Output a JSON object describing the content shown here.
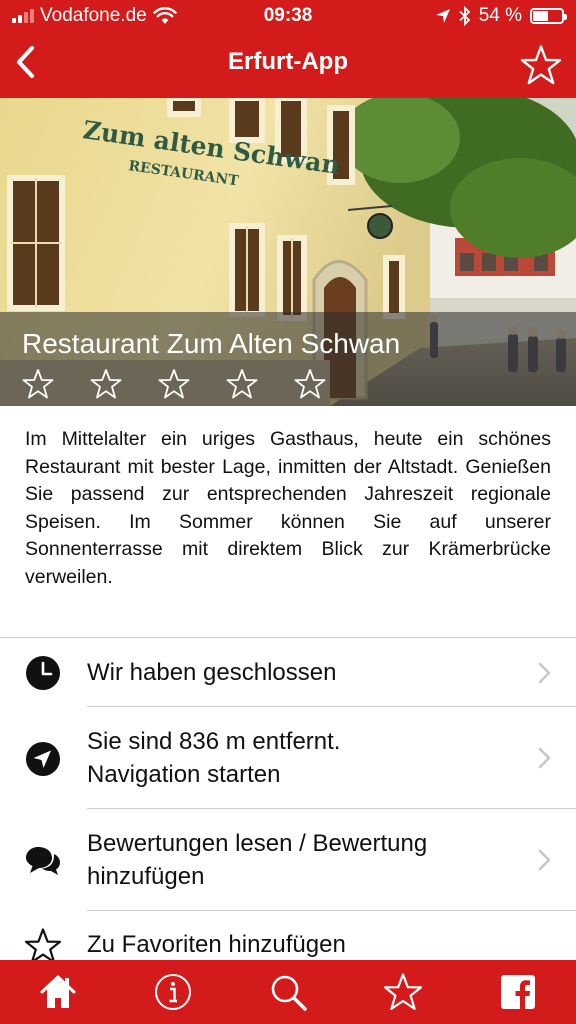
{
  "status_bar": {
    "carrier": "Vodafone.de",
    "time": "09:38",
    "battery": "54 %",
    "battery_level": 0.54
  },
  "navbar": {
    "title": "Erfurt-App",
    "back_icon": "chevron-left-icon",
    "favorite_icon": "star-outline-icon"
  },
  "hero": {
    "sign_text_1": "Zum alten Schwan",
    "sign_text_2": "RESTAURANT",
    "title": "Restaurant Zum Alten Schwan",
    "rating": 0,
    "rating_max": 5
  },
  "description": "Im Mittelalter ein uriges Gasthaus, heute ein schönes Restaurant mit bester Lage, inmitten der Altstadt. Genießen Sie passend zur entsprechenden Jahreszeit regionale Speisen. Im Sommer können Sie auf unserer Sonnenterrasse mit direktem Blick zur Krämerbrücke verweilen.",
  "list": {
    "hours": {
      "label": "Wir haben geschlossen",
      "icon": "clock-icon"
    },
    "navigation": {
      "label_line1": "Sie sind 836 m entfernt.",
      "label_line2": "Navigation starten",
      "icon": "location-arrow-icon"
    },
    "reviews": {
      "label_line1": "Bewertungen lesen / Bewertung",
      "label_line2": "hinzufügen",
      "icon": "speech-bubbles-icon"
    },
    "favorites": {
      "label": "Zu Favoriten hinzufügen",
      "icon": "star-outline-icon"
    }
  },
  "tabbar": {
    "items": [
      "home-icon",
      "info-icon",
      "search-icon",
      "star-outline-icon",
      "facebook-icon"
    ]
  },
  "colors": {
    "brand_red": "#d41b1b",
    "text": "#111111",
    "divider": "#cfcfcf",
    "chevron": "#c7c7cc"
  }
}
